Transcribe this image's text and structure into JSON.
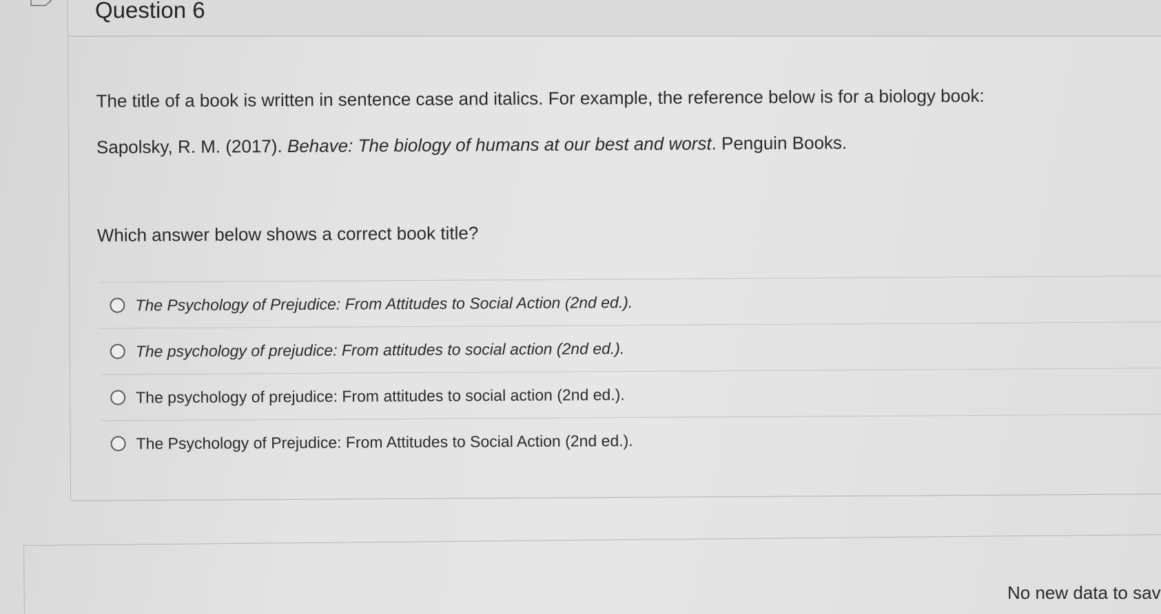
{
  "question": {
    "title": "Question 6",
    "flag_icon": "flag-icon",
    "prompt_line1": "The title of a book is written in sentence case and italics. For example, the reference below is for a biology book:",
    "reference": {
      "authors_year": "Sapolsky, R. M. (2017). ",
      "title": "Behave: The biology of humans at our best and worst",
      "publisher": ". Penguin Books."
    },
    "prompt_line2": "Which answer below shows a correct book title?",
    "options": [
      {
        "label": "The Psychology of Prejudice: From Attitudes to Social Action (2nd ed.).",
        "italic": true,
        "selected": false
      },
      {
        "label": "The psychology of prejudice: From attitudes to social action (2nd ed.).",
        "italic": true,
        "selected": false
      },
      {
        "label": "The psychology of prejudice: From attitudes to social action (2nd ed.).",
        "italic": false,
        "selected": false
      },
      {
        "label": "The Psychology of Prejudice: From Attitudes to Social Action (2nd ed.).",
        "italic": false,
        "selected": false
      }
    ]
  },
  "footer": {
    "save_status": "No new data to sav"
  }
}
